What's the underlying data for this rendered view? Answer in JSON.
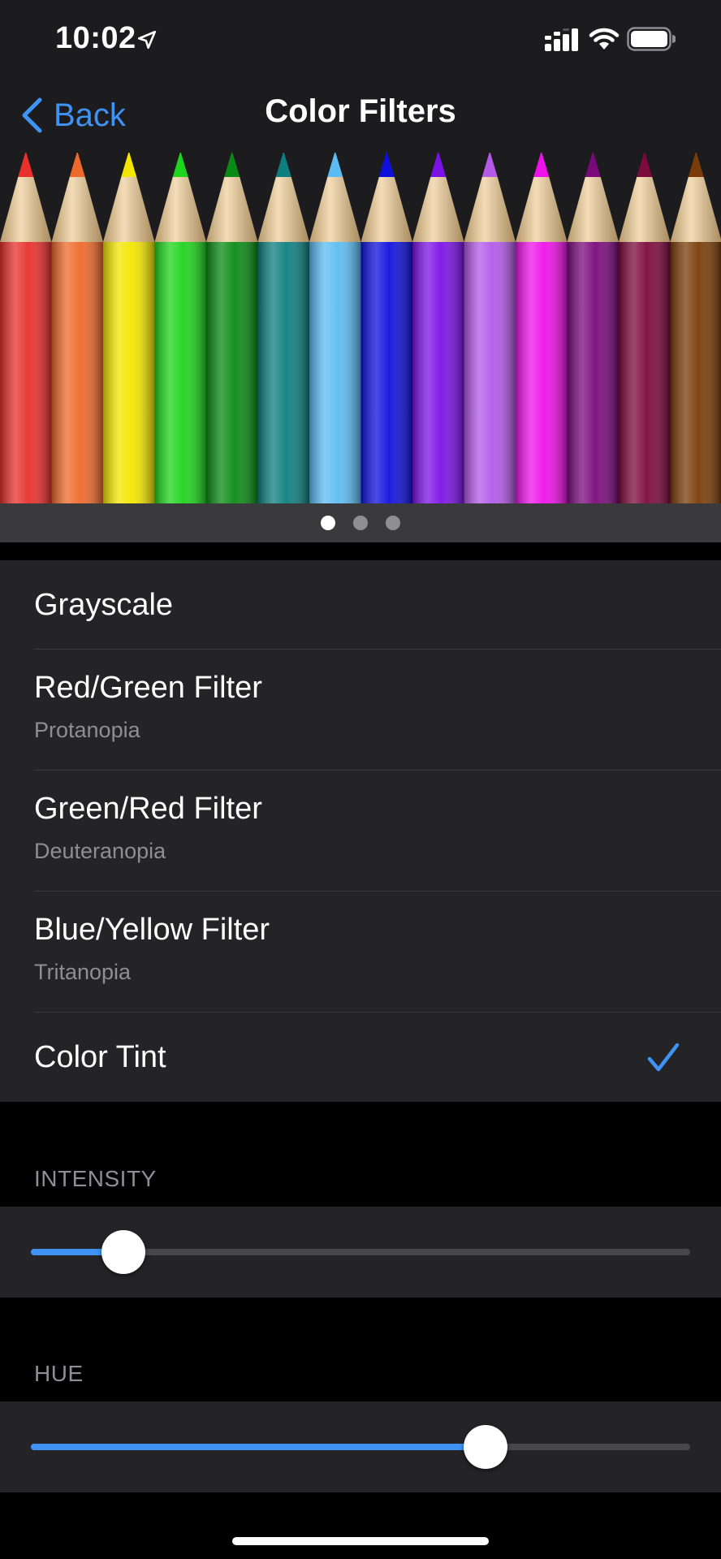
{
  "status_bar": {
    "time": "10:02",
    "icons": [
      "location-arrow-icon",
      "cellular-signal-icon",
      "wifi-icon",
      "battery-icon"
    ]
  },
  "nav": {
    "back_label": "Back",
    "title": "Color Filters",
    "accent_color": "#3e93f5"
  },
  "hero": {
    "pencil_colors": [
      "#e8302c",
      "#ee6a2c",
      "#f3e600",
      "#1ed41c",
      "#0a8a14",
      "#0d7f80",
      "#5cbcf2",
      "#1010dd",
      "#7b12e6",
      "#b35ae8",
      "#ee12e8",
      "#7a0a7c",
      "#7c0a3c",
      "#7a3c08"
    ],
    "page_count": 3,
    "active_page": 1
  },
  "filters": [
    {
      "label": "Grayscale",
      "sub": "",
      "selected": false
    },
    {
      "label": "Red/Green Filter",
      "sub": "Protanopia",
      "selected": false
    },
    {
      "label": "Green/Red Filter",
      "sub": "Deuteranopia",
      "selected": false
    },
    {
      "label": "Blue/Yellow Filter",
      "sub": "Tritanopia",
      "selected": false
    },
    {
      "label": "Color Tint",
      "sub": "",
      "selected": true
    }
  ],
  "intensity": {
    "header": "INTENSITY",
    "value": 0.14
  },
  "hue": {
    "header": "HUE",
    "value": 0.69
  }
}
